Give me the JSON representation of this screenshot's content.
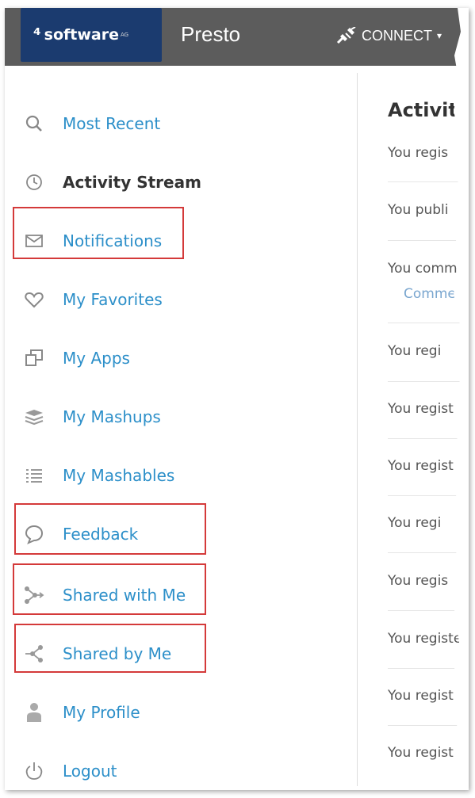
{
  "header": {
    "logo_mark": "⁴",
    "logo_text": "software",
    "logo_ag": "AG",
    "product": "Presto",
    "connect_label": "CONNECT",
    "connect_caret": "▾"
  },
  "sidebar": {
    "items": [
      {
        "label": "Most Recent",
        "icon": "search-icon"
      },
      {
        "label": "Activity Stream",
        "icon": "clock-icon",
        "active": true
      },
      {
        "label": "Notifications",
        "icon": "envelope-icon",
        "highlighted": true
      },
      {
        "label": "My Favorites",
        "icon": "heart-icon"
      },
      {
        "label": "My Apps",
        "icon": "apps-icon"
      },
      {
        "label": "My Mashups",
        "icon": "layers-icon"
      },
      {
        "label": "My Mashables",
        "icon": "list-icon"
      },
      {
        "label": "Feedback",
        "icon": "speech-bubble-icon",
        "highlighted": true
      },
      {
        "label": "Shared with Me",
        "icon": "shared-in-icon",
        "highlighted": true
      },
      {
        "label": "Shared by Me",
        "icon": "share-icon",
        "highlighted": true
      },
      {
        "label": "My Profile",
        "icon": "user-icon"
      },
      {
        "label": "Logout",
        "icon": "power-icon"
      }
    ]
  },
  "content": {
    "title": "Activit",
    "activities": [
      {
        "text": "You regis"
      },
      {
        "text": "You publi"
      },
      {
        "text": "You comm",
        "sub": "Commen"
      },
      {
        "text": "You regi"
      },
      {
        "text": "You regist"
      },
      {
        "text": "You regist"
      },
      {
        "text": "You regi"
      },
      {
        "text": "You regis"
      },
      {
        "text": "You registe"
      },
      {
        "text": "You regist"
      },
      {
        "text": "You regist"
      }
    ]
  },
  "colors": {
    "topbar": "#5c5c5c",
    "logo_bg": "#1b3b6f",
    "link": "#2c8fc9",
    "highlight_box": "#d43a3a"
  }
}
